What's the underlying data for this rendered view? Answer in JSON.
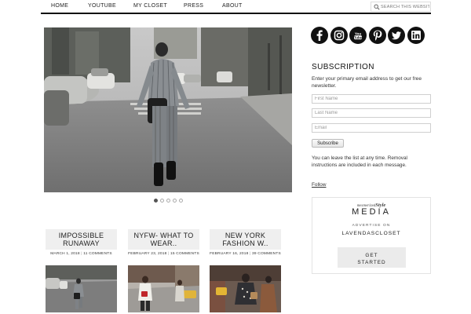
{
  "nav": {
    "items": [
      {
        "label": "HOME"
      },
      {
        "label": "YOUTUBE"
      },
      {
        "label": "MY CLOSET"
      },
      {
        "label": "PRESS"
      },
      {
        "label": "ABOUT"
      }
    ],
    "search_placeholder": "SEARCH THIS WEBSITE"
  },
  "slider": {
    "dot_count": 5,
    "active_index": 0
  },
  "posts": [
    {
      "title": "IMPOSSIBLE RUNAWAY",
      "date": "MARCH 1, 2018",
      "comments": "11 COMMENTS"
    },
    {
      "title": "NYFW- WHAT TO WEAR..",
      "date": "FEBRUARY 23, 2018",
      "comments": "15 COMMENTS"
    },
    {
      "title": "NEW YORK FASHION W..",
      "date": "FEBRUARY 16, 2018",
      "comments": "39 COMMENTS"
    }
  ],
  "social": {
    "icons": [
      "facebook-icon",
      "instagram-icon",
      "youtube-icon",
      "pinterest-icon",
      "twitter-icon",
      "linkedin-icon"
    ],
    "youtube_text": "You Tube"
  },
  "subscription": {
    "heading": "SUBSCRIPTION",
    "intro": "Enter your primary email address to get our free newsletter.",
    "first_name_placeholder": "First Name",
    "last_name_placeholder": "Last Name",
    "email_placeholder": "Email",
    "button_label": "Subscribe",
    "note": "You can leave the list at any time. Removal instructions are included in each message."
  },
  "follow_label": "Follow",
  "ad": {
    "brand_prefix": "mesmerized",
    "brand_style": "Style",
    "media": "MEDIA",
    "advertise_on": "ADVERTISE ON",
    "site_name": "LAVENDASCLOSET",
    "button_line1": "GET",
    "button_line2": "STARTED"
  },
  "colors": {
    "nav_rule": "#111111",
    "card_title_bg": "#efefef",
    "social_bg": "#111111"
  }
}
